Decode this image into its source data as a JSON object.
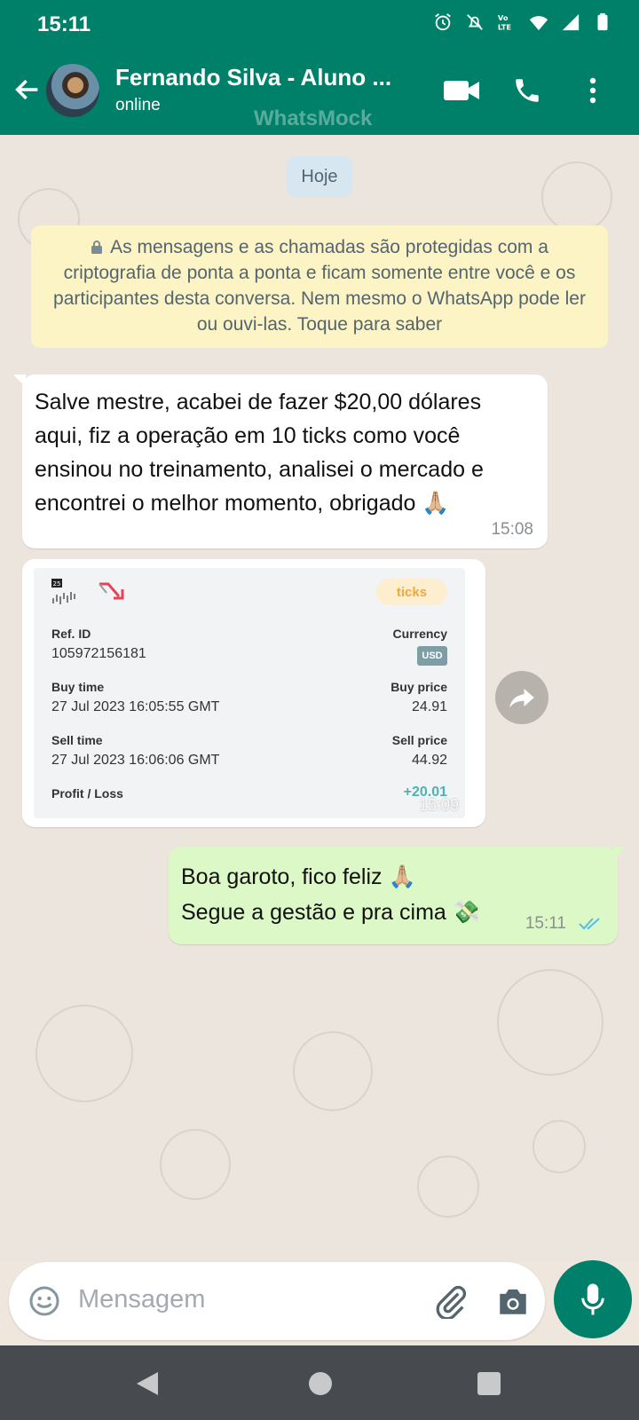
{
  "status_bar": {
    "time": "15:11"
  },
  "header": {
    "contact_name": "Fernando Silva  - Aluno ...",
    "presence": "online",
    "watermark": "WhatsMock"
  },
  "chat": {
    "date_chip": "Hoje",
    "encryption_notice": "As mensagens e as chamadas são protegidas com a criptografia de ponta a ponta e ficam somente entre você e os participantes desta conversa. Nem mesmo o WhatsApp pode ler ou ouvi-las. Toque para saber",
    "messages": [
      {
        "direction": "incoming",
        "text": "Salve mestre, acabei de fazer $20,00 dólares aqui, fiz a operação em 10 ticks como você ensinou no treinamento, analisei o mercado e encontrei o melhor momento, obrigado 🙏🏼",
        "time": "15:08"
      },
      {
        "direction": "incoming",
        "type": "image",
        "time": "15:09",
        "card": {
          "badge_small": "25",
          "pill": "ticks",
          "ref_label": "Ref. ID",
          "ref_value": "105972156181",
          "currency_label": "Currency",
          "currency_value": "USD",
          "buy_time_label": "Buy time",
          "buy_time_value": "27 Jul 2023 16:05:55 GMT",
          "buy_price_label": "Buy price",
          "buy_price_value": "24.91",
          "sell_time_label": "Sell time",
          "sell_time_value": "27 Jul 2023 16:06:06 GMT",
          "sell_price_label": "Sell price",
          "sell_price_value": "44.92",
          "profit_label": "Profit / Loss",
          "profit_value": "+20.01"
        }
      },
      {
        "direction": "outgoing",
        "line1": "Boa garoto, fico feliz 🙏🏼",
        "line2": "Segue a gestão e pra cima 💸",
        "time": "15:11",
        "status": "read"
      }
    ]
  },
  "composer": {
    "placeholder": "Mensagem"
  },
  "colors": {
    "primary": "#008069",
    "incoming_bubble": "#ffffff",
    "outgoing_bubble": "#dcf8c6",
    "read_ticks": "#53bdeb",
    "mic_button": "#00806a"
  }
}
